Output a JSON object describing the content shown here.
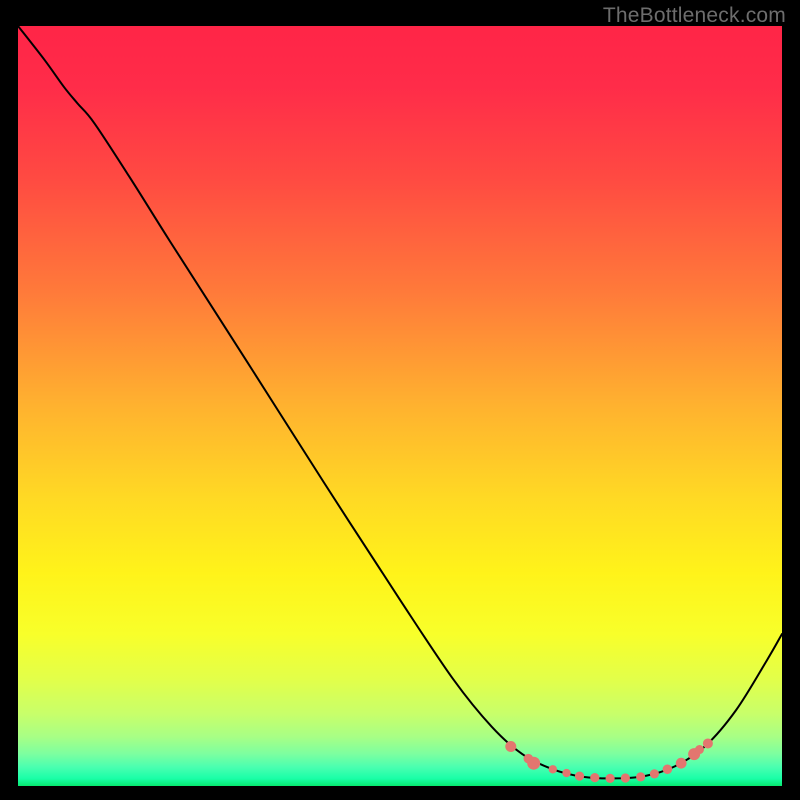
{
  "watermark": "TheBottleneck.com",
  "chart_data": {
    "type": "line",
    "title": "",
    "xlabel": "",
    "ylabel": "",
    "xlim": [
      0,
      100
    ],
    "ylim": [
      0,
      100
    ],
    "gradient_stops": [
      {
        "offset": 0.0,
        "color": "#ff2547"
      },
      {
        "offset": 0.08,
        "color": "#ff2c49"
      },
      {
        "offset": 0.2,
        "color": "#ff4a42"
      },
      {
        "offset": 0.35,
        "color": "#ff7a3a"
      },
      {
        "offset": 0.5,
        "color": "#ffb22f"
      },
      {
        "offset": 0.62,
        "color": "#ffd924"
      },
      {
        "offset": 0.72,
        "color": "#fff31a"
      },
      {
        "offset": 0.8,
        "color": "#f8ff2a"
      },
      {
        "offset": 0.86,
        "color": "#e2ff4a"
      },
      {
        "offset": 0.905,
        "color": "#c8ff6a"
      },
      {
        "offset": 0.935,
        "color": "#a8ff85"
      },
      {
        "offset": 0.958,
        "color": "#7cffa0"
      },
      {
        "offset": 0.975,
        "color": "#4affb0"
      },
      {
        "offset": 0.99,
        "color": "#1affa8"
      },
      {
        "offset": 1.0,
        "color": "#06e86f"
      }
    ],
    "series": [
      {
        "name": "bottleneck-curve",
        "points": [
          {
            "x": 0.0,
            "y": 100.0
          },
          {
            "x": 3.5,
            "y": 95.5
          },
          {
            "x": 6.0,
            "y": 92.0
          },
          {
            "x": 7.8,
            "y": 89.8
          },
          {
            "x": 10.0,
            "y": 87.2
          },
          {
            "x": 15.0,
            "y": 79.5
          },
          {
            "x": 20.0,
            "y": 71.5
          },
          {
            "x": 30.0,
            "y": 55.8
          },
          {
            "x": 40.0,
            "y": 40.0
          },
          {
            "x": 50.0,
            "y": 24.5
          },
          {
            "x": 57.0,
            "y": 14.0
          },
          {
            "x": 62.0,
            "y": 7.8
          },
          {
            "x": 66.0,
            "y": 4.2
          },
          {
            "x": 70.0,
            "y": 2.2
          },
          {
            "x": 74.0,
            "y": 1.2
          },
          {
            "x": 78.0,
            "y": 1.0
          },
          {
            "x": 82.0,
            "y": 1.3
          },
          {
            "x": 86.0,
            "y": 2.6
          },
          {
            "x": 90.0,
            "y": 5.3
          },
          {
            "x": 94.0,
            "y": 10.0
          },
          {
            "x": 98.0,
            "y": 16.5
          },
          {
            "x": 100.0,
            "y": 20.0
          }
        ]
      }
    ],
    "highlight_dots": [
      {
        "x": 64.5,
        "y": 5.2,
        "r": 5.5
      },
      {
        "x": 66.8,
        "y": 3.6,
        "r": 4.8
      },
      {
        "x": 67.5,
        "y": 3.0,
        "r": 6.5
      },
      {
        "x": 70.0,
        "y": 2.2,
        "r": 4.2
      },
      {
        "x": 71.8,
        "y": 1.7,
        "r": 4.2
      },
      {
        "x": 73.5,
        "y": 1.3,
        "r": 4.6
      },
      {
        "x": 75.5,
        "y": 1.1,
        "r": 4.6
      },
      {
        "x": 77.5,
        "y": 1.0,
        "r": 4.6
      },
      {
        "x": 79.5,
        "y": 1.05,
        "r": 4.6
      },
      {
        "x": 81.5,
        "y": 1.2,
        "r": 4.6
      },
      {
        "x": 83.3,
        "y": 1.6,
        "r": 4.6
      },
      {
        "x": 85.0,
        "y": 2.2,
        "r": 4.8
      },
      {
        "x": 86.8,
        "y": 3.0,
        "r": 5.4
      },
      {
        "x": 88.5,
        "y": 4.2,
        "r": 6.0
      },
      {
        "x": 89.2,
        "y": 4.8,
        "r": 4.5
      },
      {
        "x": 90.3,
        "y": 5.6,
        "r": 5.0
      }
    ]
  }
}
